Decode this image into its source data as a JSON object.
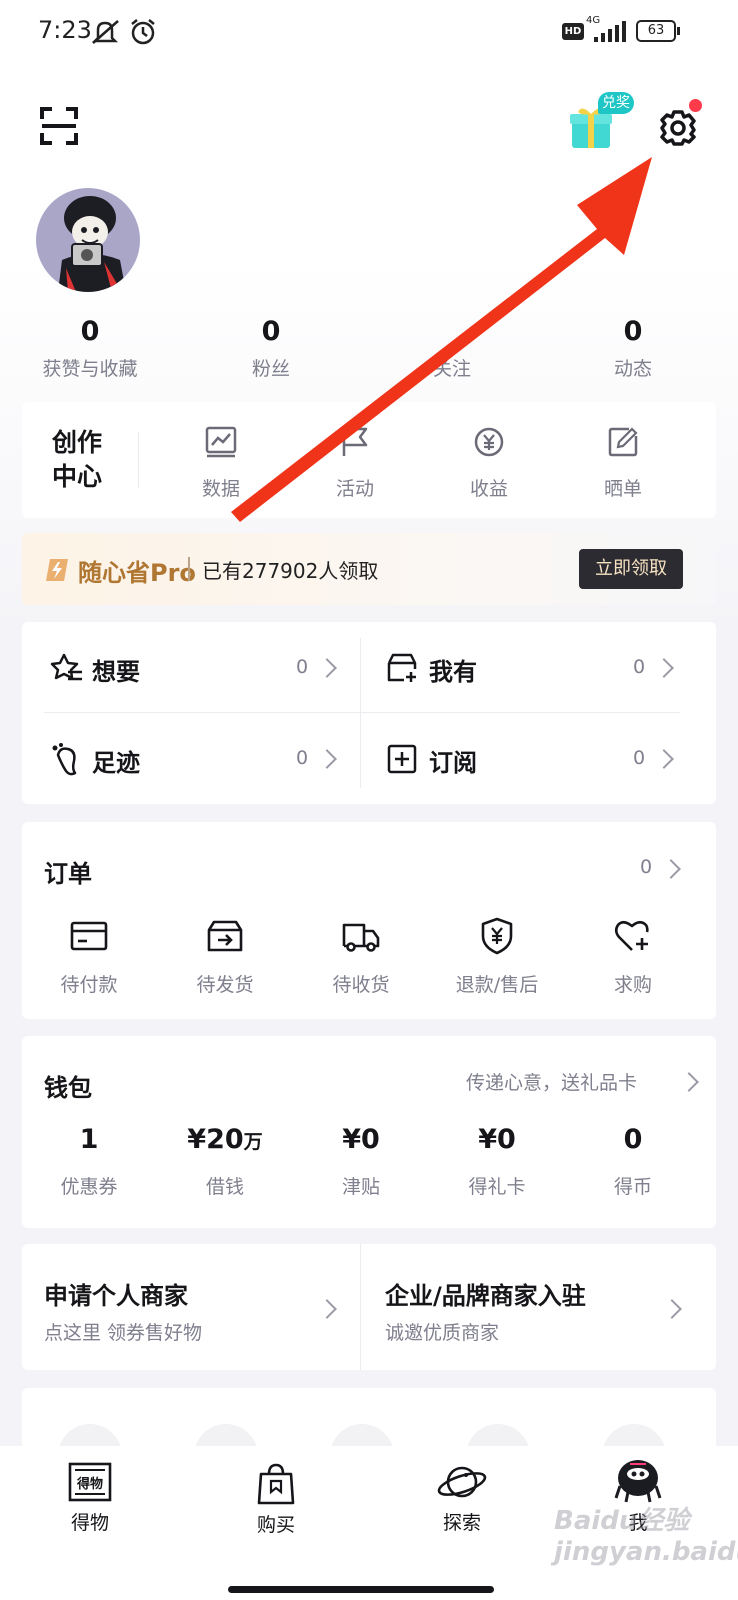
{
  "status_bar": {
    "time": "7:23",
    "network": "4G",
    "battery": "63"
  },
  "header": {
    "reward_badge": "兑奖"
  },
  "profile": {
    "stats": [
      {
        "value": "0",
        "label": "获赞与收藏"
      },
      {
        "value": "0",
        "label": "粉丝"
      },
      {
        "value": "",
        "label": "关注"
      },
      {
        "value": "0",
        "label": "动态"
      }
    ]
  },
  "creator_center": {
    "title_line1": "创作",
    "title_line2": "中心",
    "items": [
      {
        "label": "数据",
        "icon": "chart-icon"
      },
      {
        "label": "活动",
        "icon": "flag-icon"
      },
      {
        "label": "收益",
        "icon": "yen-coin-icon"
      },
      {
        "label": "晒单",
        "icon": "edit-icon"
      }
    ]
  },
  "promo": {
    "brand": "随心省Pro",
    "text": "已有277902人领取",
    "button": "立即领取"
  },
  "collections": [
    {
      "label": "想要",
      "count": "0",
      "icon": "star-list-icon"
    },
    {
      "label": "我有",
      "count": "0",
      "icon": "box-plus-icon"
    },
    {
      "label": "足迹",
      "count": "0",
      "icon": "footprint-icon"
    },
    {
      "label": "订阅",
      "count": "0",
      "icon": "plus-square-icon"
    }
  ],
  "orders": {
    "title": "订单",
    "count": "0",
    "items": [
      {
        "label": "待付款",
        "icon": "wallet-card-icon"
      },
      {
        "label": "待发货",
        "icon": "box-arrow-icon"
      },
      {
        "label": "待收货",
        "icon": "truck-icon"
      },
      {
        "label": "退款/售后",
        "icon": "shield-yen-icon"
      },
      {
        "label": "求购",
        "icon": "heart-plus-icon"
      }
    ]
  },
  "wallet": {
    "title": "钱包",
    "link": "传递心意，送礼品卡",
    "items": [
      {
        "value": "1",
        "suffix": "",
        "label": "优惠券"
      },
      {
        "value": "¥20",
        "suffix": "万",
        "label": "借钱"
      },
      {
        "value": "¥0",
        "suffix": "",
        "label": "津贴"
      },
      {
        "value": "¥0",
        "suffix": "",
        "label": "得礼卡"
      },
      {
        "value": "0",
        "suffix": "",
        "label": "得币"
      }
    ]
  },
  "merchant": {
    "personal": {
      "title": "申请个人商家",
      "subtitle": "点这里 领券售好物"
    },
    "enterprise": {
      "title": "企业/品牌商家入驻",
      "subtitle": "诚邀优质商家"
    }
  },
  "bottom_nav": [
    {
      "label": "得物",
      "icon": "dewu-logo-icon"
    },
    {
      "label": "购买",
      "icon": "shopping-bag-icon"
    },
    {
      "label": "探索",
      "icon": "planet-icon"
    },
    {
      "label": "我",
      "icon": "profile-avatar-icon"
    }
  ],
  "watermark": "Baidu经验 jingyan.baidu.com",
  "colors": {
    "arrow": "#f0341a",
    "accent_teal": "#1ec6c6",
    "badge_red": "#ff3b4b",
    "promo_button": "#2b2b31"
  }
}
